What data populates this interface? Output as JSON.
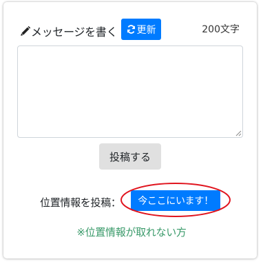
{
  "compose": {
    "title": "メッセージを書く",
    "pencil_icon": "pencil-icon",
    "refresh_button_label": "更新",
    "refresh_icon": "refresh-icon",
    "char_count": "200文字",
    "textarea_value": "",
    "post_button_label": "投稿する"
  },
  "location": {
    "label": "位置情報を投稿：",
    "button_label": "今ここにいます！",
    "help_link": "※位置情報が取れない方"
  },
  "colors": {
    "primary": "#007bff",
    "help_link": "#3a9a6a",
    "highlight": "#e0141e",
    "post_button_bg": "#e0e0e0"
  }
}
